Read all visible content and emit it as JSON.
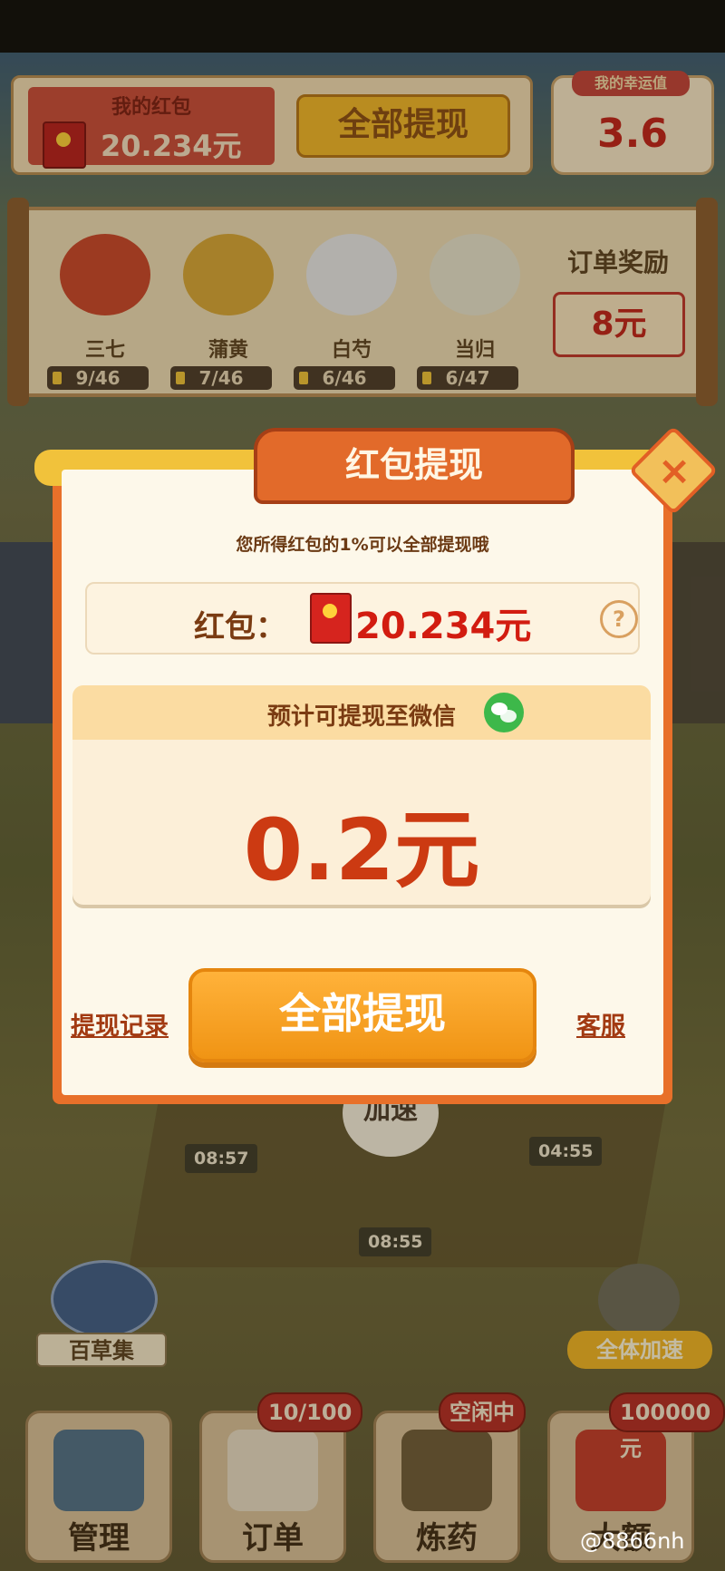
{
  "top": {
    "redpack_title": "我的红包",
    "redpack_amount": "20.234元",
    "withdraw_all": "全部提现",
    "lucky_label": "我的幸运值",
    "lucky_value": "3.6"
  },
  "order": {
    "herbs": [
      {
        "name": "三七",
        "progress": "9/46"
      },
      {
        "name": "蒲黄",
        "progress": "7/46"
      },
      {
        "name": "白芍",
        "progress": "6/46"
      },
      {
        "name": "当归",
        "progress": "6/47"
      }
    ],
    "reward_label": "订单奖励",
    "reward_value": "8元"
  },
  "farm": {
    "timers": [
      "08:57",
      "04:55",
      "08:55"
    ],
    "speed_label": "加速"
  },
  "bottom": {
    "herbbook": "百草集",
    "all_speed": "全体加速",
    "nav": [
      {
        "label": "管理"
      },
      {
        "label": "订单",
        "badge": "10/100"
      },
      {
        "label": "炼药",
        "badge": "空闲中"
      },
      {
        "label": "大额",
        "badge": "100000元"
      }
    ]
  },
  "modal": {
    "title": "红包提现",
    "subtitle": "您所得红包的1%可以全部提现哦",
    "redpack_label": "红包：",
    "redpack_amount": "20.234元",
    "help": "?",
    "estimate_label": "预计可提现至微信",
    "estimate_value": "0.2元",
    "record_link": "提现记录",
    "withdraw_button": "全部提现",
    "service_link": "客服",
    "close": "×"
  },
  "watermark": "@8866nh",
  "colors": {
    "accent_orange": "#e8702a",
    "red": "#d21c10",
    "gold": "#f1c23b",
    "wechat_green": "#3db84a"
  }
}
